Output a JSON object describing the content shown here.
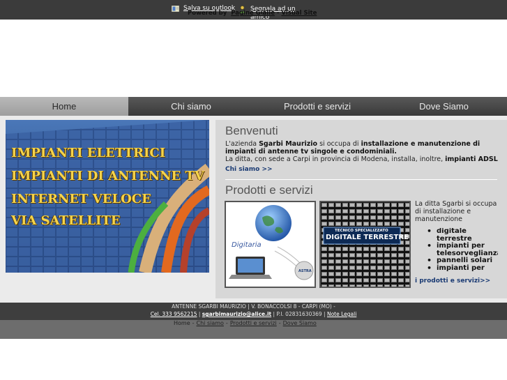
{
  "topbar": {
    "outlook_label": "Salva su outlook",
    "amico_label": "Segnala ad un amico"
  },
  "nav": [
    {
      "label": "Home",
      "active": true
    },
    {
      "label": "Chi siamo",
      "active": false
    },
    {
      "label": "Prodotti e servizi",
      "active": false
    },
    {
      "label": "Dove Siamo",
      "active": false
    }
  ],
  "hero": {
    "lines": [
      "IMPIANTI ELETTRICI",
      "IMPIANTI DI ANTENNE TV",
      "INTERNET VELOCE",
      "VIA SATELLITE"
    ]
  },
  "welcome": {
    "title": "Benvenuti",
    "p1_a": "L'azienda ",
    "p1_b": "Sgarbi Maurizio",
    "p1_c": " si occupa di ",
    "p1_d": "installazione e manutenzione di impianti di antenne tv singole e condominiali.",
    "p2_a": "La ditta, con sede a Carpi in provincia di Modena, installa, inoltre, ",
    "p2_b": "impianti ADSL",
    "link": "Chi siamo >>"
  },
  "products": {
    "title": "Prodotti e servizi",
    "desc": "La ditta Sgarbi si occupa di installazione e manutenzione",
    "items": [
      "digitale terrestre",
      "impianti per telesorveglianza",
      "pannelli solari",
      "impianti per"
    ],
    "link": "i prodotti e servizi>>",
    "img1_brand": "Digitaria",
    "img1_badge": "ASTRA",
    "img2_top": "TECNICO SPECIALIZZATO",
    "img2_main": "DIGITALE TERRESTRE"
  },
  "footer": {
    "line1": "ANTENNE SGARBI MAURIZIO | V. BONACCOLSI 8 - CARPI (MO) -",
    "cel": "Cel. 333 9562215",
    "email": "sgarbimaurizio@alice.it",
    "piva": "P.I. 02831630369",
    "legal": "Note Legali",
    "nav_home": "Home",
    "nav_chi": "Chi siamo",
    "nav_prod": "Prodotti e servizi",
    "nav_dove": "Dove Siamo",
    "powered_by": "Powered by",
    "pg": "Pagine Gialle",
    "vs": "Visual Site"
  },
  "colors": {
    "dark_bar": "#3b3b3b",
    "nav_active": "#b0b0b0",
    "hero_text": "#f5d44c",
    "link": "#1a3a73"
  }
}
